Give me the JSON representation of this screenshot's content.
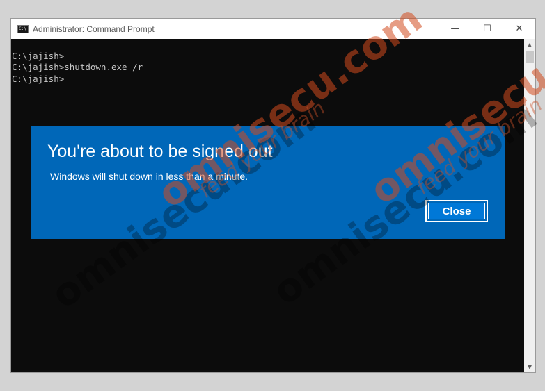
{
  "window": {
    "title": "Administrator: Command Prompt",
    "icon_label": "C:\\",
    "controls": {
      "minimize": "—",
      "maximize": "☐",
      "close": "✕"
    }
  },
  "console": {
    "lines": [
      "C:\\jajish>",
      "C:\\jajish>shutdown.exe /r",
      "",
      "C:\\jajish>"
    ]
  },
  "dialog": {
    "title": "You're about to be signed out",
    "message": "Windows will shut down in less than a minute.",
    "close_label": "Close",
    "background_color": "#0067b8"
  },
  "watermark": {
    "text": "omnisecu.com",
    "tagline": "feed your brain"
  }
}
